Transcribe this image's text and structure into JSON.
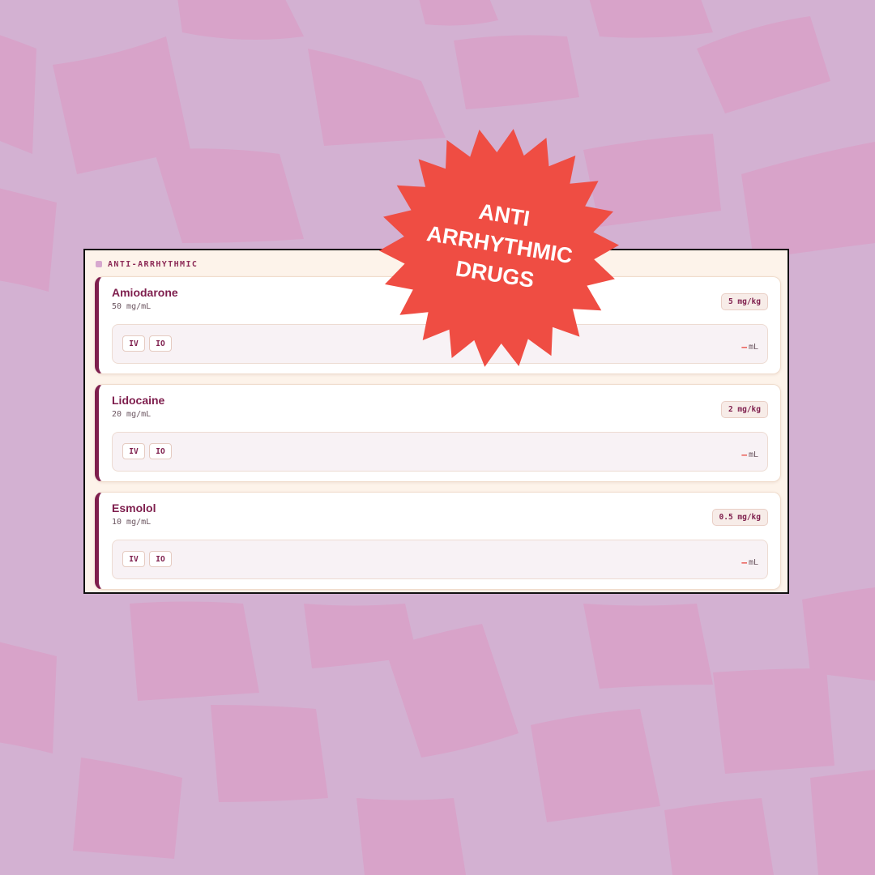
{
  "colors": {
    "background": "#d3b1d2",
    "tiles": "#d8a3c9",
    "panel": "#fdf3ea",
    "accent": "#7e1e4d",
    "stamp": "#ef4d43",
    "result": "#e8483f"
  },
  "section": {
    "label": "ANTI-ARRHYTHMIC",
    "dot_icon": "square-dot-icon"
  },
  "drugs": [
    {
      "name": "Amiodarone",
      "concentration": "50 mg/mL",
      "dose": "5 mg/kg",
      "routes": [
        "IV",
        "IO"
      ],
      "result": "—",
      "unit": "mL"
    },
    {
      "name": "Lidocaine",
      "concentration": "20 mg/mL",
      "dose": "2 mg/kg",
      "routes": [
        "IV",
        "IO"
      ],
      "result": "—",
      "unit": "mL"
    },
    {
      "name": "Esmolol",
      "concentration": "10 mg/mL",
      "dose": "0.5 mg/kg",
      "routes": [
        "IV",
        "IO"
      ],
      "result": "—",
      "unit": "mL"
    }
  ],
  "stamp": {
    "line1": "ANTI",
    "line2": "ARRHYTHMIC",
    "line3": "DRUGS",
    "icon": "starburst-badge-icon"
  }
}
